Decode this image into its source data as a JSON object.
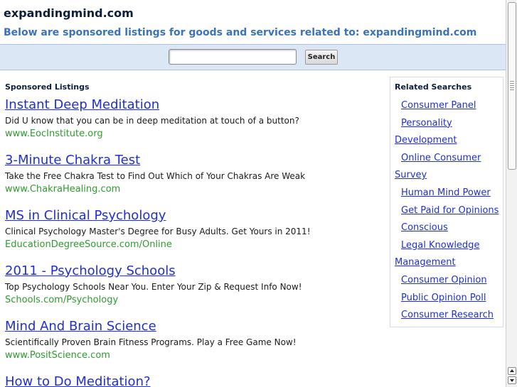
{
  "header": {
    "site_title": "expandingmind.com",
    "subtitle": "Below are sponsored listings for goods and services related to: expandingmind.com"
  },
  "search": {
    "value": "",
    "button_label": "Search"
  },
  "listings": {
    "heading": "Sponsored Listings",
    "items": [
      {
        "title": "Instant Deep Meditation",
        "description": "Did U know that you can be in deep meditation at touch of a button?",
        "url": "www.EocInstitute.org"
      },
      {
        "title": "3-Minute Chakra Test",
        "description": "Take the Free Chakra Test to Find Out Which of Your Chakras Are Weak",
        "url": "www.ChakraHealing.com"
      },
      {
        "title": "MS in Clinical Psychology",
        "description": "Clinical Psychology Master's Degree for Busy Adults. Get Yours in 2011!",
        "url": "EducationDegreeSource.com/Online"
      },
      {
        "title": "2011 - Psychology Schools",
        "description": "Top Psychology Schools Near You. Enter Your Zip & Request Info Now!",
        "url": "Schools.com/Psychology"
      },
      {
        "title": "Mind And Brain Science",
        "description": "Scientifically Proven Brain Fitness Programs. Play a Free Game Now!",
        "url": "www.PositScience.com"
      },
      {
        "title": "How to Do Meditation?",
        "description": "",
        "url": ""
      }
    ]
  },
  "related": {
    "heading": "Related Searches",
    "lines": [
      "Consumer Panel",
      "Personality",
      "Development",
      "Online Consumer",
      "Survey",
      "Human Mind Power",
      "Get Paid for Opinions",
      "Conscious",
      "Legal Knowledge",
      "Management",
      "Consumer Opinion",
      "Public Opinion Poll",
      "Consumer Research"
    ]
  },
  "icons": {
    "scroll_up": "arrow-up-icon",
    "scroll_down": "arrow-down-icon"
  },
  "colors": {
    "link": "#1f2fd0",
    "url": "#2f9a2f",
    "subtitle": "#3b72b8",
    "search_band": "#dce7f5"
  }
}
